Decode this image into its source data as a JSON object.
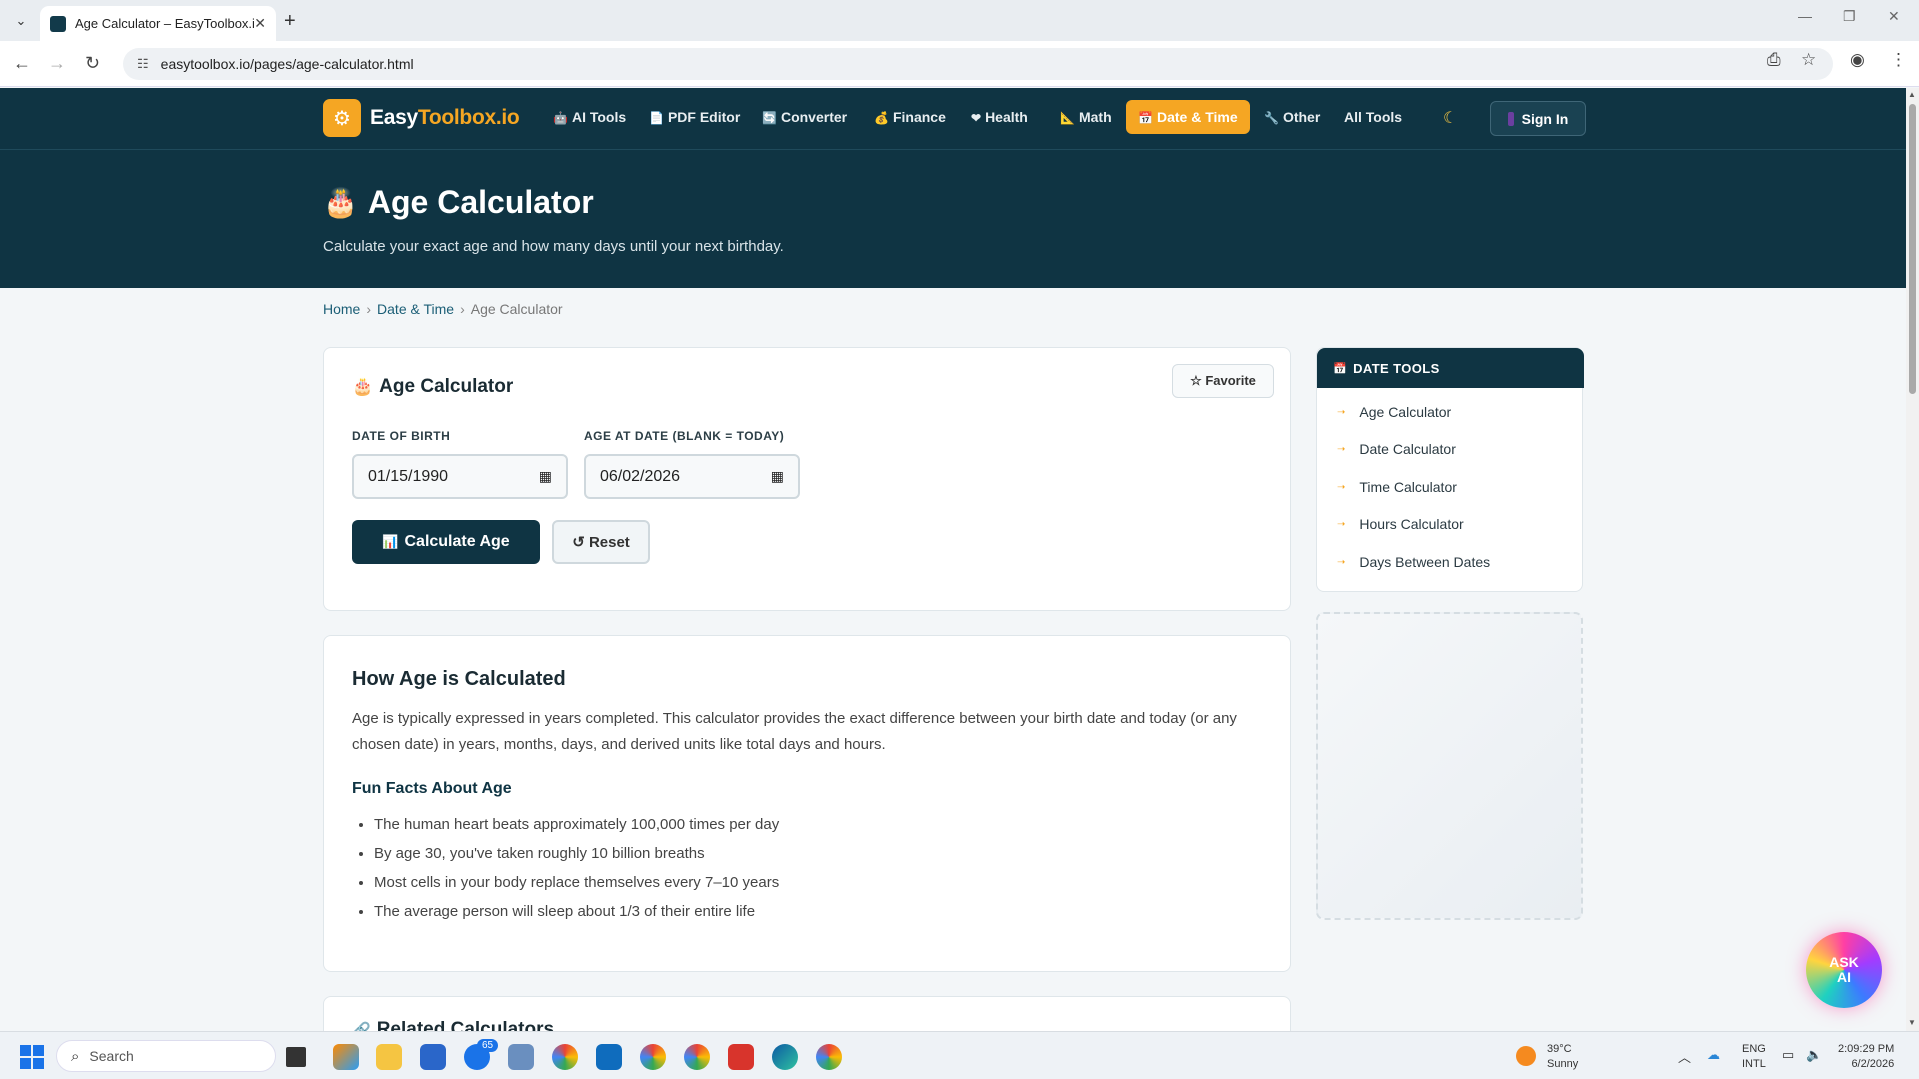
{
  "browser": {
    "tab_title": "Age Calculator – EasyToolbox.io",
    "url": "easytoolbox.io/pages/age-calculator.html"
  },
  "site": {
    "logo_main": "EasyToolbox",
    "logo_accent": ".io",
    "nav": [
      {
        "label": "AI Tools",
        "icon": "robot-icon",
        "glyph": "🤖"
      },
      {
        "label": "PDF Editor",
        "icon": "document-icon",
        "glyph": "📄"
      },
      {
        "label": "Converter",
        "icon": "converter-icon",
        "glyph": "🔄"
      },
      {
        "label": "Finance",
        "icon": "money-bag-icon",
        "glyph": "💰"
      },
      {
        "label": "Health",
        "icon": "heart-icon",
        "glyph": "❤"
      },
      {
        "label": "Math",
        "icon": "ruler-icon",
        "glyph": "📐"
      },
      {
        "label": "Date & Time",
        "icon": "calendar-icon",
        "glyph": "📅",
        "active": true
      },
      {
        "label": "Other",
        "icon": "wrench-icon",
        "glyph": "🔧"
      },
      {
        "label": "All Tools"
      }
    ],
    "sign_in": "Sign In",
    "accent_color": "#f5a623",
    "primary_color": "#0f3443"
  },
  "hero": {
    "title": "Age Calculator",
    "subtitle": "Calculate your exact age and how many days until your next birthday."
  },
  "breadcrumb": [
    "Home",
    "Date & Time",
    "Age Calculator"
  ],
  "calculator": {
    "title": "Age Calculator",
    "favorite": "☆ Favorite",
    "dob_label": "DATE OF BIRTH",
    "dob_value": "01/15/1990",
    "at_label": "AGE AT DATE (BLANK = TODAY)",
    "at_value": "06/02/2026",
    "calc_button": "Calculate Age",
    "reset_button": "↺ Reset"
  },
  "info": {
    "heading": "How Age is Calculated",
    "paragraph": "Age is typically expressed in years completed. This calculator provides the exact difference between your birth date and today (or any chosen date) in years, months, days, and derived units like total days and hours.",
    "facts_heading": "Fun Facts About Age",
    "facts": [
      "The human heart beats approximately 100,000 times per day",
      "By age 30, you've taken roughly 10 billion breaths",
      "Most cells in your body replace themselves every 7–10 years",
      "The average person will sleep about 1/3 of their entire life"
    ]
  },
  "related": {
    "heading": "Related Calculators"
  },
  "sidebar": {
    "heading": "DATE TOOLS",
    "items": [
      "Age Calculator",
      "Date Calculator",
      "Time Calculator",
      "Hours Calculator",
      "Days Between Dates"
    ]
  },
  "ask_ai": {
    "line1": "ASK",
    "line2": "AI"
  },
  "taskbar": {
    "search_placeholder": "Search",
    "badge_count": "65",
    "temp": "39°C",
    "condition": "Sunny",
    "lang1": "ENG",
    "lang2": "INTL",
    "time": "2:09:29 PM",
    "date": "6/2/2026"
  }
}
